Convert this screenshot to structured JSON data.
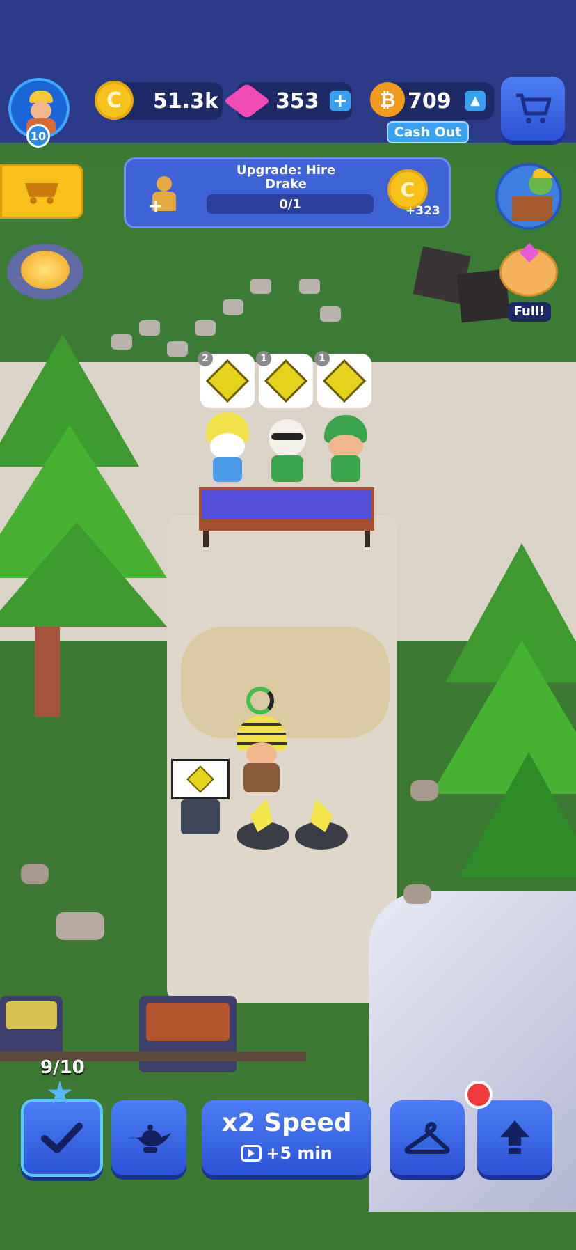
{
  "player": {
    "level": "10"
  },
  "currencies": {
    "coins": "51.3k",
    "gems": "353",
    "bitcoin": "709",
    "cash_out_label": "Cash Out"
  },
  "upgrade_task": {
    "title": "Upgrade: Hire\nDrake",
    "progress": "0/1",
    "progress_fraction": 0,
    "reward": "+323"
  },
  "side": {
    "piggy_label": "Full!"
  },
  "workers": [
    {
      "count": "2"
    },
    {
      "count": "1"
    },
    {
      "count": "1"
    }
  ],
  "bottom": {
    "tasks_progress": "9/10",
    "speed_label": "x2 Speed",
    "speed_sub": "+5 min"
  },
  "colors": {
    "hud_bg": "#2b3b87",
    "button_blue": "#3b66e8",
    "coin_gold": "#f7c21b",
    "gem_pink": "#f24bb3",
    "bitcoin_orange": "#f29a1b",
    "grass": "#3c7a33",
    "path": "#d9cfc2"
  },
  "icons": {
    "coin": "coin-icon",
    "gem": "gem-icon",
    "bitcoin": "bitcoin-icon",
    "cart": "cart-icon",
    "check": "check-icon",
    "lamp": "lamp-icon",
    "hanger": "hanger-icon",
    "arrow_up": "arrow-up-icon",
    "video": "video-icon"
  }
}
